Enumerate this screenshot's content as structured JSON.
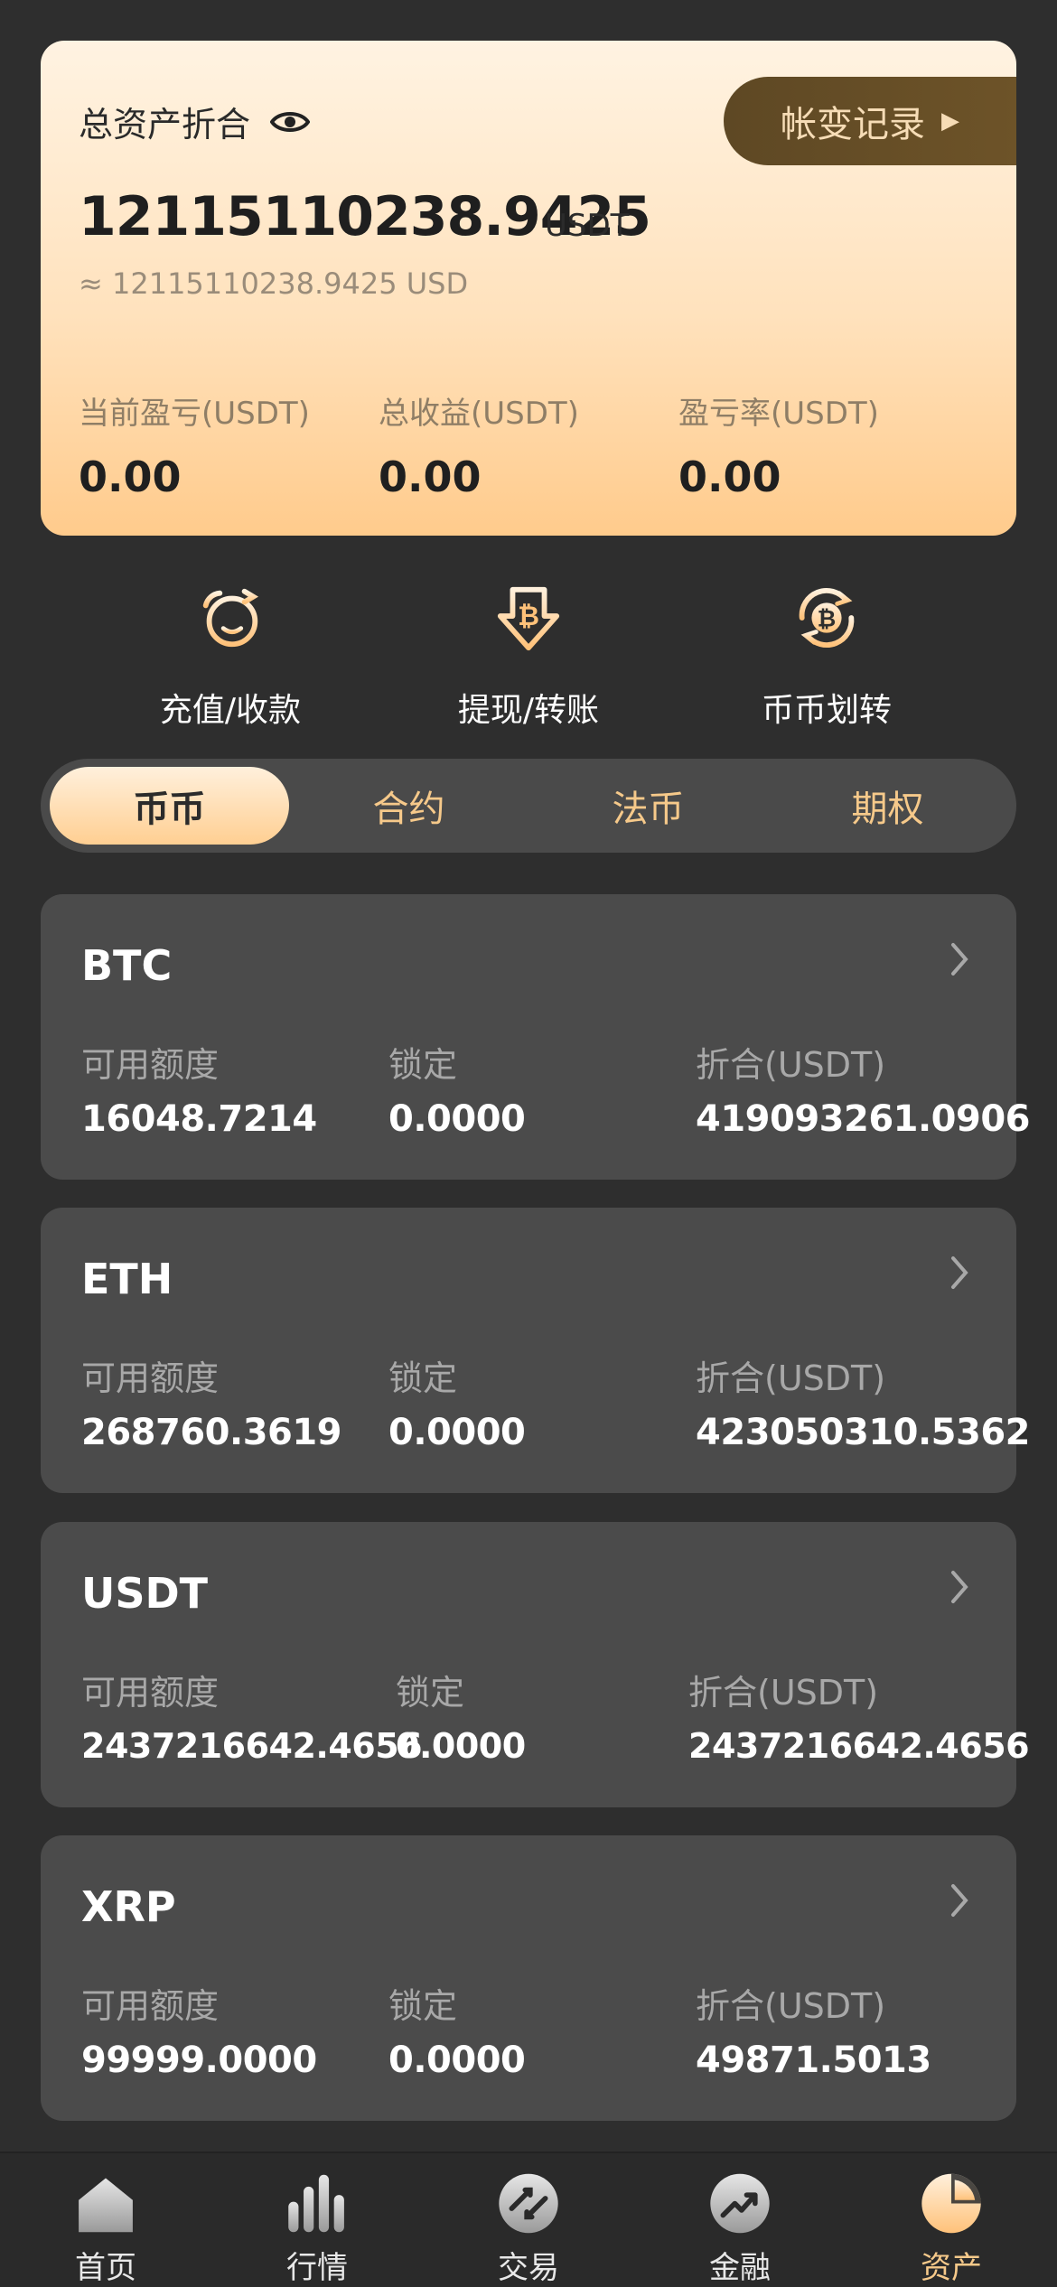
{
  "summary": {
    "title": "总资产折合",
    "history_label": "帐变记录",
    "total": "12115110238.9425",
    "unit": "USDT",
    "approx": "≈ 12115110238.9425 USD",
    "stats": [
      {
        "label": "当前盈亏(USDT)",
        "value": "0.00"
      },
      {
        "label": "总收益(USDT)",
        "value": "0.00"
      },
      {
        "label": "盈亏率(USDT)",
        "value": "0.00"
      }
    ]
  },
  "actions": [
    {
      "label": "充值/收款",
      "icon": "deposit-icon"
    },
    {
      "label": "提现/转账",
      "icon": "withdraw-icon"
    },
    {
      "label": "币币划转",
      "icon": "transfer-icon"
    }
  ],
  "tabs": [
    "币币",
    "合约",
    "法币",
    "期权"
  ],
  "columns": {
    "available": "可用额度",
    "locked": "锁定",
    "value": "折合(USDT)"
  },
  "coins": [
    {
      "name": "BTC",
      "available": "16048.7214",
      "locked": "0.0000",
      "value": "419093261.0906"
    },
    {
      "name": "ETH",
      "available": "268760.3619",
      "locked": "0.0000",
      "value": "423050310.5362"
    },
    {
      "name": "USDT",
      "available": "2437216642.4656",
      "locked": "0.0000",
      "value": "2437216642.4656"
    },
    {
      "name": "XRP",
      "available": "99999.0000",
      "locked": "0.0000",
      "value": "49871.5013"
    }
  ],
  "nav": [
    {
      "label": "首页",
      "icon": "home-icon"
    },
    {
      "label": "行情",
      "icon": "market-icon"
    },
    {
      "label": "交易",
      "icon": "trade-icon"
    },
    {
      "label": "金融",
      "icon": "finance-icon"
    },
    {
      "label": "资产",
      "icon": "assets-icon"
    }
  ],
  "colors": {
    "accent": "#f6c98a",
    "card": "#4b4b4b",
    "background": "#2e2e2e"
  }
}
